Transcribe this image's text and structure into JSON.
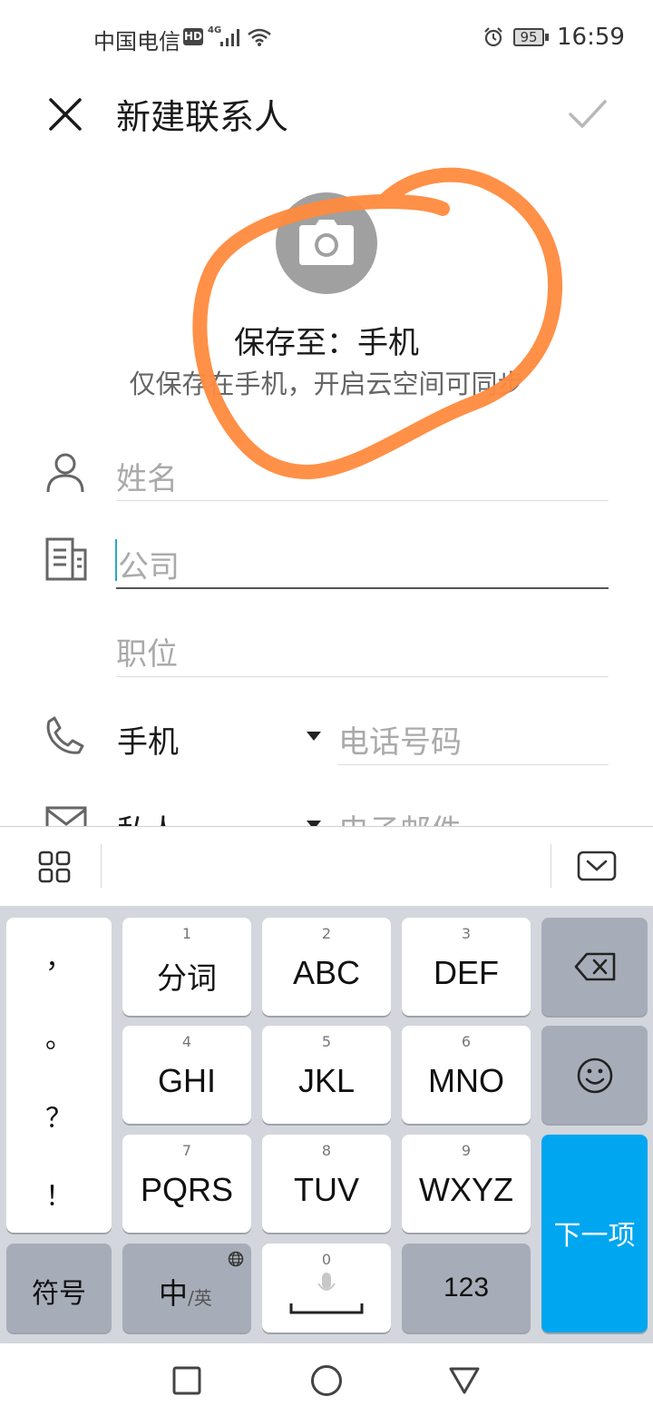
{
  "status_bar": {
    "carrier": "中国电信",
    "hd": "HD",
    "network": "4G",
    "battery": "95",
    "time": "16:59"
  },
  "header": {
    "title": "新建联系人",
    "close_icon": "close-icon",
    "confirm_icon": "check-icon"
  },
  "avatar": {
    "icon": "camera-icon",
    "save_to": "保存至：手机",
    "hint": "仅保存在手机，开启云空间可同步"
  },
  "form": {
    "name_placeholder": "姓名",
    "company_placeholder": "公司",
    "title_placeholder": "职位",
    "phone_type": "手机",
    "phone_placeholder": "电话号码",
    "email_type": "私人",
    "email_placeholder": "电子邮件"
  },
  "keyboard": {
    "punctuation": [
      "，",
      "。",
      "？",
      "！"
    ],
    "keys": [
      {
        "num": "1",
        "label": "分词"
      },
      {
        "num": "2",
        "label": "ABC"
      },
      {
        "num": "3",
        "label": "DEF"
      },
      {
        "num": "4",
        "label": "GHI"
      },
      {
        "num": "5",
        "label": "JKL"
      },
      {
        "num": "6",
        "label": "MNO"
      },
      {
        "num": "7",
        "label": "PQRS"
      },
      {
        "num": "8",
        "label": "TUV"
      },
      {
        "num": "9",
        "label": "WXYZ"
      }
    ],
    "symbols": "符号",
    "lang_main": "中",
    "lang_alt": "/英",
    "space_num": "0",
    "numbers": "123",
    "next": "下一项"
  },
  "colors": {
    "annotation": "#ff8a3d",
    "accent_key": "#00a6f0",
    "caret": "#2aa8c8"
  }
}
